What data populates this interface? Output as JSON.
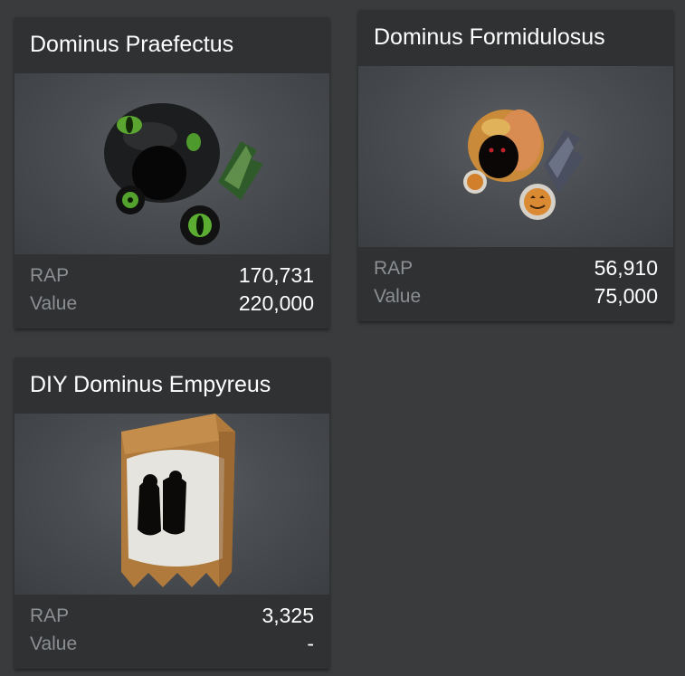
{
  "items": [
    {
      "name": "Dominus Praefectus",
      "rap_label": "RAP",
      "rap": "170,731",
      "value_label": "Value",
      "value": "220,000",
      "thumbnail_icon": "dominus-praefectus-hat-icon"
    },
    {
      "name": "Dominus Formidulosus",
      "rap_label": "RAP",
      "rap": "56,910",
      "value_label": "Value",
      "value": "75,000",
      "thumbnail_icon": "dominus-formidulosus-hat-icon"
    },
    {
      "name": "DIY Dominus Empyreus",
      "rap_label": "RAP",
      "rap": "3,325",
      "value_label": "Value",
      "value": "-",
      "thumbnail_icon": "diy-dominus-empyreus-hat-icon"
    }
  ],
  "colors": {
    "background": "#393b3d",
    "card": "#2f3133",
    "label": "#8c8f92",
    "text": "#ffffff"
  }
}
